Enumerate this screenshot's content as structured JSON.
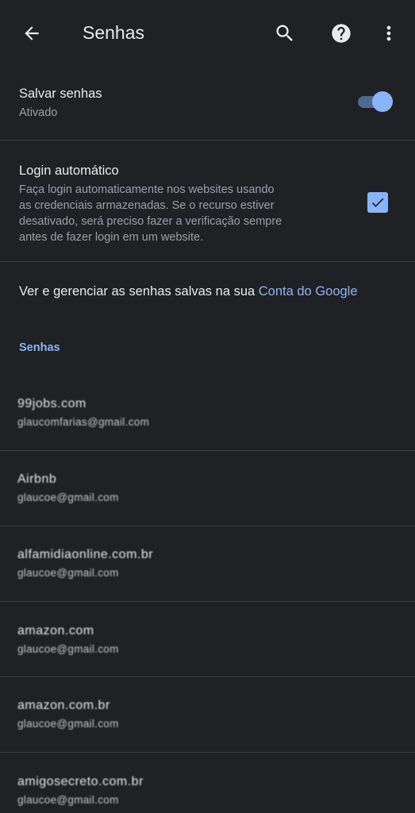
{
  "appbar": {
    "title": "Senhas",
    "icons": [
      "arrow-back-icon",
      "search-icon",
      "help-icon",
      "more-vert-icon"
    ]
  },
  "save_passwords": {
    "label": "Salvar senhas",
    "status": "Ativado",
    "enabled": true
  },
  "auto_login": {
    "label": "Login automático",
    "description_lines": [
      "Faça login automaticamente nos websites usando",
      "as credenciais armazenadas. Se o recurso estiver",
      "desativado, será preciso fazer a verificação sempre",
      "antes de fazer login em um website."
    ],
    "checked": true
  },
  "manage": {
    "text": "Ver e gerenciar as senhas salvas na sua ",
    "link": "Conta do Google"
  },
  "section_header": "Senhas",
  "passwords": [
    {
      "site": "99jobs.com",
      "user": "glaucomfarias@gmail.com"
    },
    {
      "site": "Airbnb",
      "user": "glaucoe@gmail.com"
    },
    {
      "site": "alfamidiaonline.com.br",
      "user": "glaucoe@gmail.com"
    },
    {
      "site": "amazon.com",
      "user": "glaucoe@gmail.com"
    },
    {
      "site": "amazon.com.br",
      "user": "glaucoe@gmail.com"
    },
    {
      "site": "amigosecreto.com.br",
      "user": "glaucoe@gmail.com"
    }
  ],
  "colors": {
    "background": "#202124",
    "accent": "#8ab4f8",
    "divider": "#3c3d40"
  }
}
